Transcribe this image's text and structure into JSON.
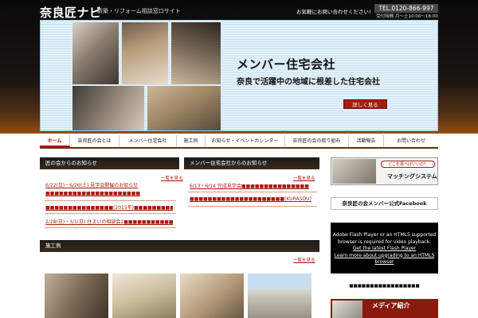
{
  "header": {
    "logo": "奈良匠ナビ",
    "tagline": "新築・リフォーム相談窓口サイト",
    "contact_message": "お気軽にお問い合わせください!",
    "tel": "TEL.0120-866-997",
    "hours": "受付時間 月～土10:00～18:00"
  },
  "hero": {
    "title": "メンバー住宅会社",
    "subtitle": "奈良で活躍中の地域に根差した住宅会社",
    "button_label": "詳しく見る"
  },
  "nav": {
    "items": [
      {
        "label": "ホーム",
        "active": true
      },
      {
        "label": "奈良匠の会とは",
        "active": false
      },
      {
        "label": "メンバー住宅会社",
        "active": false
      },
      {
        "label": "施工例",
        "active": false
      },
      {
        "label": "お知らせ・イベントカレンダー",
        "active": false
      },
      {
        "label": "奈良匠の会の取り組み",
        "active": false
      },
      {
        "label": "活動報告",
        "active": false
      },
      {
        "label": "お問い合わせ",
        "active": false
      }
    ]
  },
  "news": {
    "heading": "匠の会からのお知らせ",
    "more": "一覧を見る",
    "items": [
      "6/22(日)・6/26(土) 見学会開催のお知らせ■■■■■■■■■■■■■■■■■■■■■",
      "■■■■■■■■■■■■■■■(2015年)■■■■■■■■■■■",
      "2/28(日)・3/1(日) 住まいの相談会2■■■■■■■■■■■■■■■■■■"
    ]
  },
  "member_news": {
    "heading": "メンバー住宅会社からのお知らせ",
    "more": "一覧を見る",
    "items": [
      "6/13・6/14 完成見学会■■■■■■■■■■■■■■■",
      "■■■■■■■■■■■■■■■■■■■■■(KURASOU)"
    ]
  },
  "works": {
    "heading": "施工例",
    "more": "一覧を見る"
  },
  "sidebar": {
    "matching_bubble": "どこを選べばいいの？",
    "matching_title": "マッチングシステム",
    "facebook_title": "奈良匠の会メンバー公式Facebook",
    "flash_line1": "Adobe Flash Player or an HTML5 supported browser is required for video playback.",
    "flash_link1": "Get the latest Flash Player",
    "flash_link2": "Learn more about upgrading to an HTML5 browser",
    "video_caption": "■■■■■■■■■■■■■■■■■",
    "media_title": "メディア紹介"
  },
  "colors": {
    "accent": "#a51c10",
    "header_dark": "#0a0a0a",
    "nav_border": "#5a3414"
  }
}
